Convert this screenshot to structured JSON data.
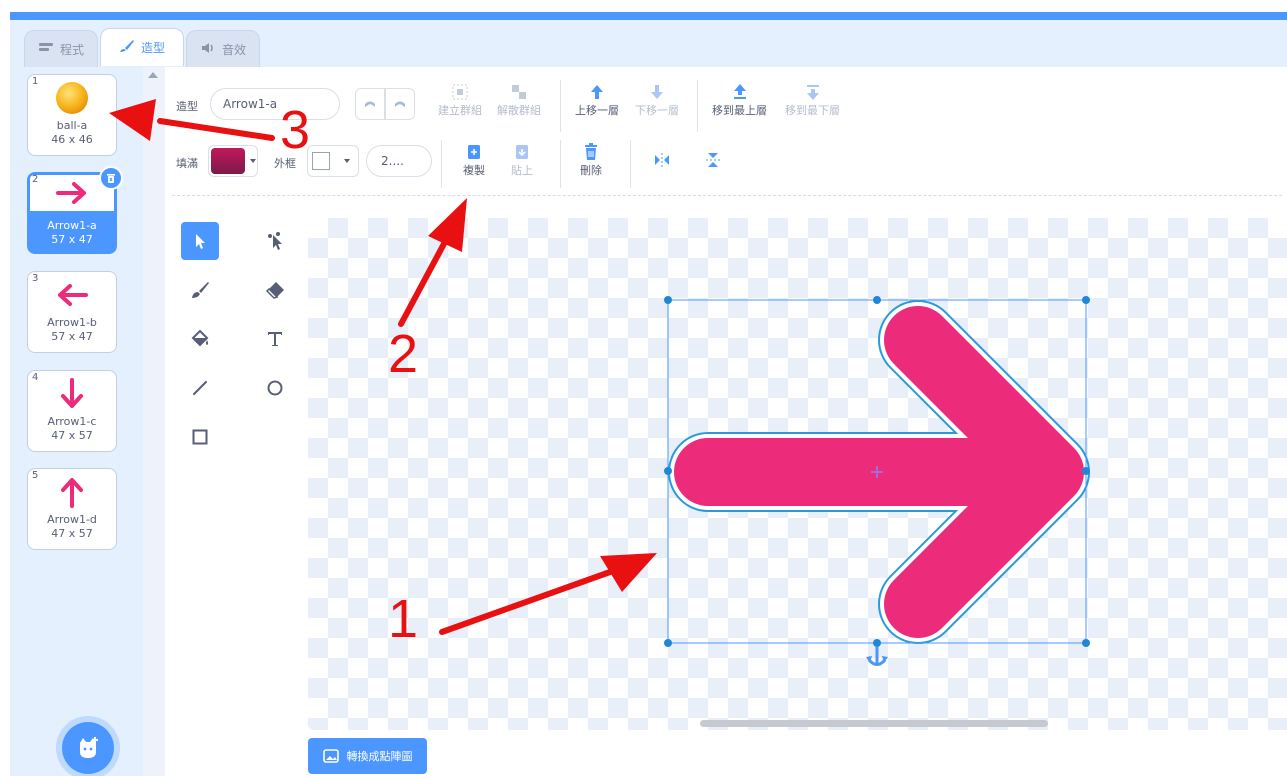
{
  "tabs": [
    {
      "label": "程式",
      "icon": "code-icon"
    },
    {
      "label": "造型",
      "icon": "paintbrush-icon"
    },
    {
      "label": "音效",
      "icon": "speaker-icon"
    }
  ],
  "costumes": [
    {
      "index": "1",
      "name": "ball-a",
      "size": "46 x 46"
    },
    {
      "index": "2",
      "name": "Arrow1-a",
      "size": "57 x 47"
    },
    {
      "index": "3",
      "name": "Arrow1-b",
      "size": "57 x 47"
    },
    {
      "index": "4",
      "name": "Arrow1-c",
      "size": "47 x 57"
    },
    {
      "index": "5",
      "name": "Arrow1-d",
      "size": "47 x 57"
    }
  ],
  "editor": {
    "costume_label": "造型",
    "costume_name": "Arrow1-a",
    "fill_label": "填滿",
    "outline_label": "外框",
    "stroke_width": "2....",
    "fill_color": "#c2185b",
    "toolbar": {
      "group": "建立群組",
      "ungroup": "解散群組",
      "forward": "上移一層",
      "backward": "下移一層",
      "front": "移到最上層",
      "back": "移到最下層",
      "copy": "複製",
      "paste": "貼上",
      "delete": "刪除"
    },
    "convert_button": "轉換成點陣圖"
  },
  "annotations": {
    "one": "1",
    "two": "2",
    "three": "3"
  },
  "colors": {
    "accent": "#4c97ff",
    "arrow": "#ec2b7a",
    "annotation": "#e81010"
  }
}
